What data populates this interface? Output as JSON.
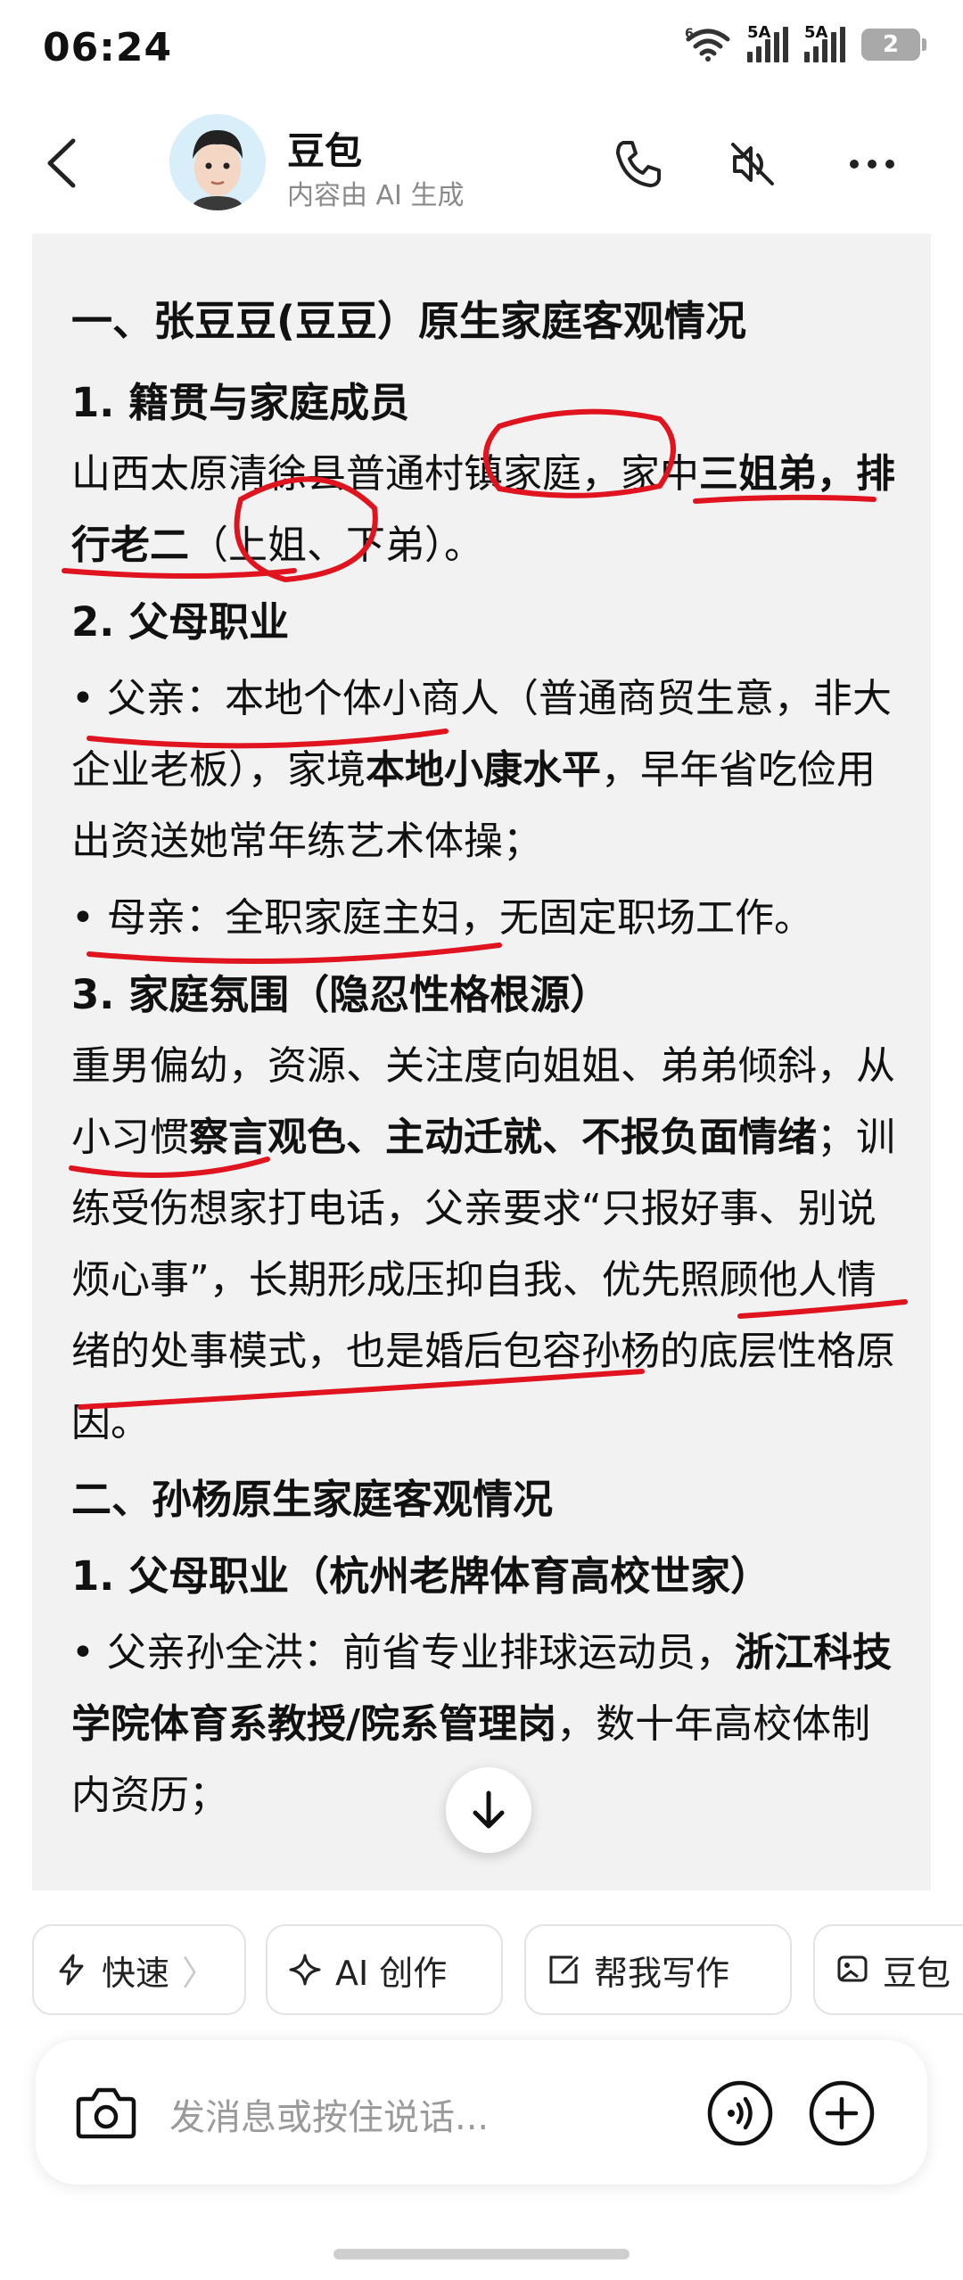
{
  "status_bar": {
    "time": "06:24",
    "signal1_tag": "5A",
    "signal2_tag": "5A",
    "battery": "2",
    "wifi_tag": "6"
  },
  "header": {
    "name": "豆包",
    "subtitle": "内容由 AI 生成",
    "icons": [
      "back-icon",
      "phone-icon",
      "speaker-muted-icon",
      "more-icon"
    ]
  },
  "content": {
    "section1_title": "一、张豆豆(豆豆）原生家庭客观情况",
    "s1_item1_title": "1. 籍贯与家庭成员",
    "s1_item1_text_a": "山西太原清徐县普通村镇家庭，家中",
    "s1_item1_text_b": "三姐弟，排行老二",
    "s1_item1_text_c": "（上姐、下弟）。",
    "s1_item2_title": "2. 父母职业",
    "father_a": "父亲：本地个体小商人（普通商贸生意，非大企业老板），家境",
    "father_b": "本地小康水平",
    "father_c": "，早年省吃俭用出资送她常年练艺术体操；",
    "mother_a": "母亲：全职家庭主妇",
    "mother_b": "，无固定职场工作。",
    "s1_item3_title": "3. 家庭氛围（隐忍性格根源）",
    "atmo_a": "重男偏幼",
    "atmo_b": "，资源、关注度向姐姐、弟弟倾斜，从小习惯",
    "atmo_c": "察言观色、主动迁就、不报负面情绪",
    "atmo_d": "；训练受伤想家打电话，父亲要求“只报好事、别说烦心事”，长期形成压抑自我、优先照顾他人情绪的处事模式，也是婚后包容孙杨的底层性格原因。",
    "section2_title": "二、孙杨原生家庭客观情况",
    "s2_item1_title": "1. 父母职业（杭州老牌体育高校世家）",
    "sun_father_a": "父亲孙全洪：前省专业排球运动员，",
    "sun_father_b": "浙江科技学院体育系",
    "sun_father_c": "教授/院系管理岗",
    "sun_father_d": "，数十年高校体制内资历；"
  },
  "chips": {
    "fast": "快速",
    "fast_arrow": "〉",
    "ai_create": "AI 创作",
    "help_write": "帮我写作",
    "doubao": "豆包"
  },
  "input": {
    "placeholder": "发消息或按住说话..."
  },
  "colors": {
    "annotation_red": "#e0141e",
    "card_bg": "#f2f2f2"
  }
}
